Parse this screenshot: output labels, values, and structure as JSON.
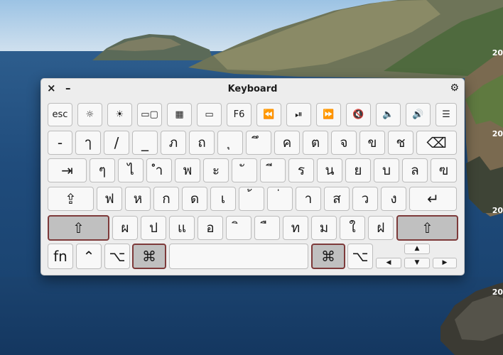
{
  "window": {
    "title": "Keyboard",
    "close": "×",
    "minimize": "–",
    "settings": "⚙"
  },
  "desktop": {
    "dates": [
      "20",
      "20",
      "20",
      "20"
    ]
  },
  "rows": {
    "function": [
      "esc",
      "☼",
      "☀",
      "▭▢",
      "▦",
      "▭",
      "F6",
      "⏪",
      "⏯",
      "⏩",
      "🔇",
      "🔈",
      "🔊",
      "☰"
    ],
    "numbers": [
      "-",
      "ๅ",
      "/",
      "_",
      "ภ",
      "ถ",
      "ุ",
      "ึ",
      "ค",
      "ต",
      "จ",
      "ข",
      "ช",
      "⌫"
    ],
    "top": [
      "⇥",
      "ๆ",
      "ไ",
      "ำ",
      "พ",
      "ะ",
      "ั",
      "ี",
      "ร",
      "น",
      "ย",
      "บ",
      "ล",
      "ฃ"
    ],
    "home": [
      "⇪",
      "ฟ",
      "ห",
      "ก",
      "ด",
      "เ",
      "้",
      "่",
      "า",
      "ส",
      "ว",
      "ง",
      "↵"
    ],
    "shift": [
      "⇧",
      "ผ",
      "ป",
      "แ",
      "อ",
      "ิ",
      "ื",
      "ท",
      "ม",
      "ใ",
      "ฝ",
      "⇧"
    ],
    "bottom": [
      "fn",
      "⌃",
      "⌥",
      "⌘",
      "",
      "⌘",
      "⌥",
      "▲",
      "◀",
      "▼",
      "▶"
    ]
  }
}
